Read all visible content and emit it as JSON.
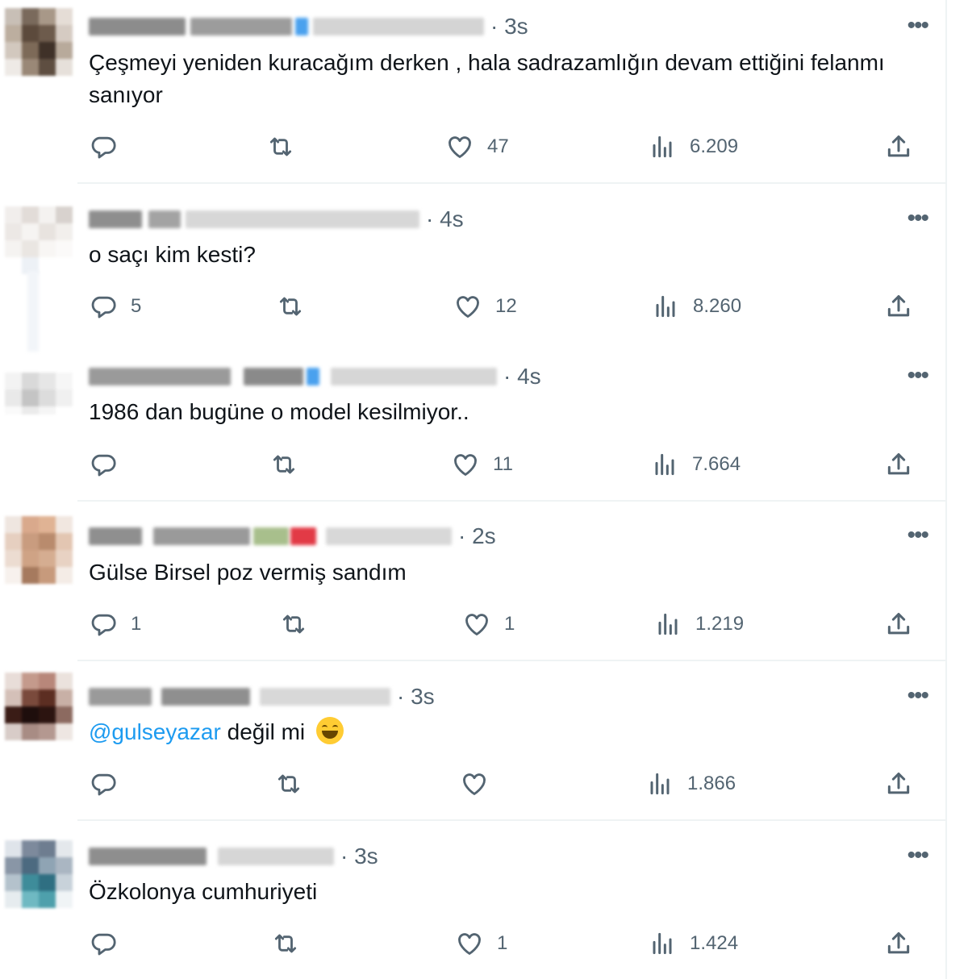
{
  "colors": {
    "text": "#0f1419",
    "muted": "#536471",
    "accent": "#1d9bf0",
    "divider": "#eff3f4"
  },
  "icons": {
    "reply": "reply-icon",
    "retweet": "retweet-icon",
    "like": "heart-icon",
    "views": "views-icon",
    "share": "share-icon",
    "more": "more-icon"
  },
  "tweets": [
    {
      "time": "· 3s",
      "text": "Çeşmeyi yeniden kuracağım derken , hala sadrazamlığın devam ettiğini felanmı sanıyor",
      "mention": "",
      "reply_count": "",
      "retweet_count": "",
      "like_count": "47",
      "view_count": "6.209"
    },
    {
      "time": "· 4s",
      "text": "o saçı kim kesti?",
      "mention": "",
      "reply_count": "5",
      "retweet_count": "",
      "like_count": "12",
      "view_count": "8.260"
    },
    {
      "time": "· 4s",
      "text": "1986 dan bugüne o model kesilmiyor..",
      "mention": "",
      "reply_count": "",
      "retweet_count": "",
      "like_count": "11",
      "view_count": "7.664"
    },
    {
      "time": "· 2s",
      "text": "Gülse Birsel poz vermiş sandım",
      "mention": "",
      "reply_count": "1",
      "retweet_count": "",
      "like_count": "1",
      "view_count": "1.219"
    },
    {
      "time": "· 3s",
      "text": "değil mi",
      "mention": "@gulseyazar",
      "reply_count": "",
      "retweet_count": "",
      "like_count": "",
      "view_count": "1.866"
    },
    {
      "time": "· 3s",
      "text": "Özkolonya cumhuriyeti",
      "mention": "",
      "reply_count": "",
      "retweet_count": "",
      "like_count": "1",
      "view_count": "1.424"
    }
  ]
}
